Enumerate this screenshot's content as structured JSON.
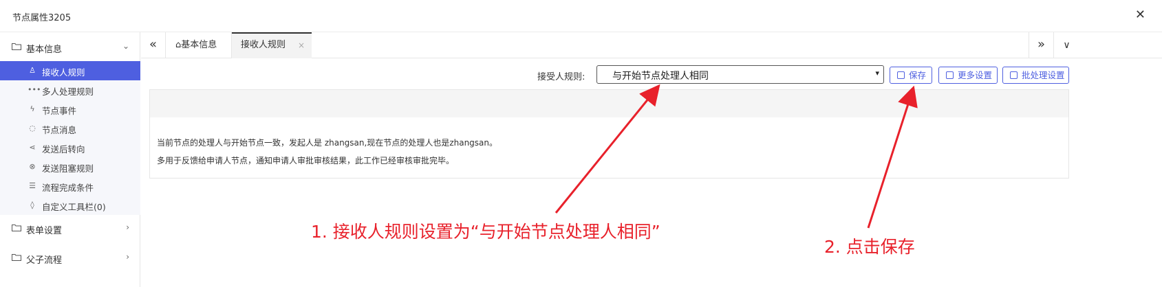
{
  "window": {
    "title": "节点属性3205",
    "close_glyph": "✕"
  },
  "sidebar": {
    "groups": [
      {
        "label": "基本信息",
        "icon": "folder-icon",
        "expanded": true
      },
      {
        "label": "表单设置",
        "icon": "folder-icon",
        "expanded": false
      },
      {
        "label": "父子流程",
        "icon": "folder-icon",
        "expanded": false
      }
    ],
    "items": [
      {
        "label": "接收人规则",
        "icon": "user-rule-icon",
        "active": true
      },
      {
        "label": "多人处理规则",
        "icon": "more-dots-icon"
      },
      {
        "label": "节点事件",
        "icon": "lightning-icon"
      },
      {
        "label": "节点消息",
        "icon": "chat-icon"
      },
      {
        "label": "发送后转向",
        "icon": "share-icon"
      },
      {
        "label": "发送阻塞规则",
        "icon": "close-circle-icon"
      },
      {
        "label": "流程完成条件",
        "icon": "list-icon"
      },
      {
        "label": "自定义工具栏(0)",
        "icon": "drop-icon"
      }
    ]
  },
  "tabs": {
    "home_label": "基本信息",
    "active_label": "接收人规则",
    "close_glyph": "×"
  },
  "toolbar": {
    "rule_label": "接受人规则:",
    "rule_value": "与开始节点处理人相同",
    "save_label": "保存",
    "more_label": "更多设置",
    "batch_label": "批处理设置"
  },
  "content": {
    "line1": "当前节点的处理人与开始节点一致，发起人是 zhangsan,现在节点的处理人也是zhangsan。",
    "line2": "多用于反馈给申请人节点，通知申请人审批审核结果，此工作已经审核审批完毕。"
  },
  "annotations": {
    "step1": "1. 接收人规则设置为“与开始节点处理人相同”",
    "step2": "2. 点击保存",
    "color": "#e8212b"
  },
  "colors": {
    "accent": "#4e5fe0"
  }
}
